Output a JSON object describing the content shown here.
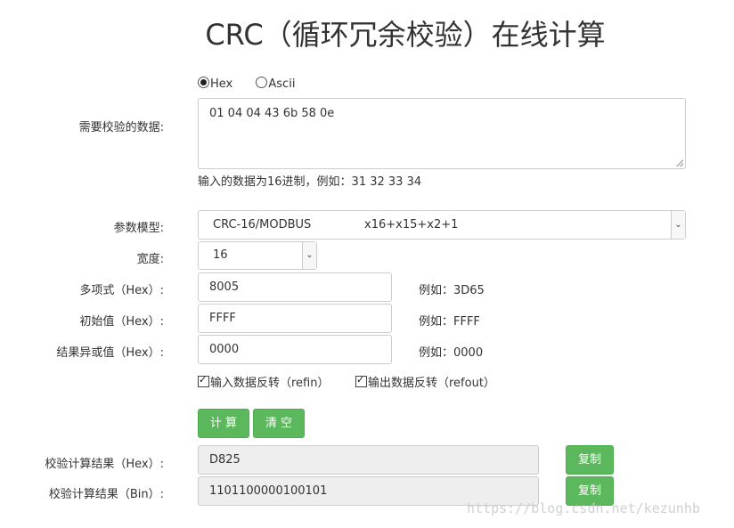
{
  "page_title": "CRC（循环冗余校验）在线计算",
  "format": {
    "options": [
      "Hex",
      "Ascii"
    ],
    "selected": "Hex"
  },
  "data_input": {
    "label": "需要校验的数据:",
    "value": "01 04 04 43 6b 58 0e",
    "hint": "输入的数据为16进制，例如：31 32 33 34"
  },
  "model": {
    "label": "参数模型:",
    "value": "CRC-16/MODBUS",
    "polynomial": "x16+x15+x2+1"
  },
  "width": {
    "label": "宽度:",
    "value": "16"
  },
  "poly": {
    "label": "多项式（Hex）:",
    "value": "8005",
    "example": "例如：3D65"
  },
  "init": {
    "label": "初始值（Hex）:",
    "value": "FFFF",
    "example": "例如：FFFF"
  },
  "xorout": {
    "label": "结果异或值（Hex）:",
    "value": "0000",
    "example": "例如：0000"
  },
  "refin": {
    "label": "输入数据反转（refin）",
    "checked": true
  },
  "refout": {
    "label": "输出数据反转（refout）",
    "checked": true
  },
  "buttons": {
    "calculate": "计 算",
    "clear": "清 空",
    "copy": "复制"
  },
  "result_hex": {
    "label": "校验计算结果（Hex）:",
    "value": "D825"
  },
  "result_bin": {
    "label": "校验计算结果（Bin）:",
    "value": "1101100000100101"
  },
  "watermark": "https://blog.csdn.net/kezunhb",
  "colors": {
    "button_green": "#5cb85c",
    "readonly_bg": "#eeeeee"
  }
}
